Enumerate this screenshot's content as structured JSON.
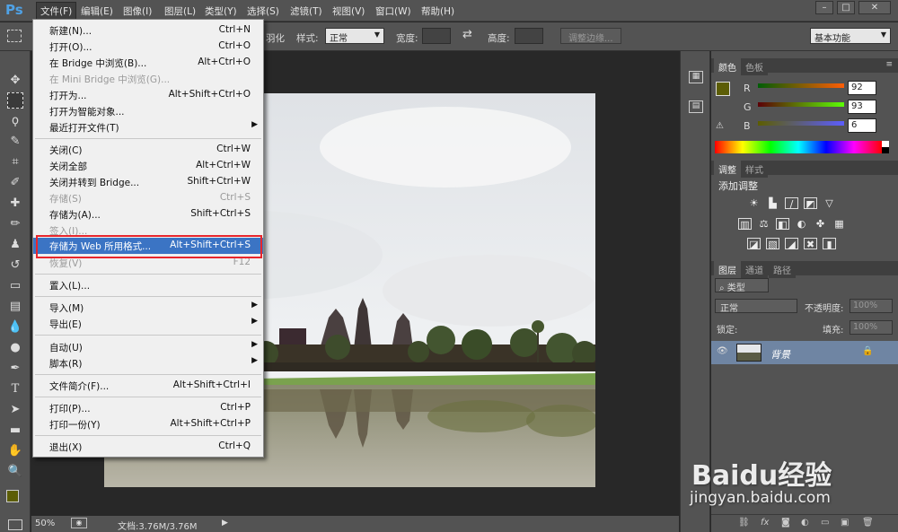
{
  "app": {
    "logo": "Ps"
  },
  "menubar": {
    "items": [
      "文件(F)",
      "编辑(E)",
      "图像(I)",
      "图层(L)",
      "类型(Y)",
      "选择(S)",
      "滤镜(T)",
      "视图(V)",
      "窗口(W)",
      "帮助(H)"
    ],
    "window_buttons": [
      "–",
      "□",
      "✕"
    ]
  },
  "options": {
    "feather_tail": "羽化",
    "style_label": "样式:",
    "style_value": "正常",
    "width_label": "宽度:",
    "height_label": "高度:",
    "refine_button": "调整边缘...",
    "workspace": "基本功能"
  },
  "file_menu": {
    "new": {
      "label": "新建(N)...",
      "shortcut": "Ctrl+N"
    },
    "open": {
      "label": "打开(O)...",
      "shortcut": "Ctrl+O"
    },
    "browse_bridge": {
      "label": "在 Bridge 中浏览(B)...",
      "shortcut": "Alt+Ctrl+O"
    },
    "browse_mini": {
      "label": "在 Mini Bridge 中浏览(G)...",
      "shortcut": ""
    },
    "open_as": {
      "label": "打开为...",
      "shortcut": "Alt+Shift+Ctrl+O"
    },
    "open_smart": {
      "label": "打开为智能对象...",
      "shortcut": ""
    },
    "recent": {
      "label": "最近打开文件(T)",
      "shortcut": ""
    },
    "close": {
      "label": "关闭(C)",
      "shortcut": "Ctrl+W"
    },
    "close_all": {
      "label": "关闭全部",
      "shortcut": "Alt+Ctrl+W"
    },
    "close_bridge": {
      "label": "关闭并转到 Bridge...",
      "shortcut": "Shift+Ctrl+W"
    },
    "save": {
      "label": "存储(S)",
      "shortcut": "Ctrl+S"
    },
    "save_as": {
      "label": "存储为(A)...",
      "shortcut": "Shift+Ctrl+S"
    },
    "checkin": {
      "label": "签入(I)...",
      "shortcut": ""
    },
    "save_web": {
      "label": "存储为 Web 所用格式...",
      "shortcut": "Alt+Shift+Ctrl+S"
    },
    "revert": {
      "label": "恢复(V)",
      "shortcut": "F12"
    },
    "place": {
      "label": "置入(L)...",
      "shortcut": ""
    },
    "import": {
      "label": "导入(M)",
      "shortcut": ""
    },
    "export": {
      "label": "导出(E)",
      "shortcut": ""
    },
    "automate": {
      "label": "自动(U)",
      "shortcut": ""
    },
    "scripts": {
      "label": "脚本(R)",
      "shortcut": ""
    },
    "file_info": {
      "label": "文件简介(F)...",
      "shortcut": "Alt+Shift+Ctrl+I"
    },
    "print": {
      "label": "打印(P)...",
      "shortcut": "Ctrl+P"
    },
    "print_one": {
      "label": "打印一份(Y)",
      "shortcut": "Alt+Shift+Ctrl+P"
    },
    "exit": {
      "label": "退出(X)",
      "shortcut": "Ctrl+Q"
    }
  },
  "status": {
    "zoom": "50%",
    "doc": "文档:3.76M/3.76M"
  },
  "color_panel": {
    "tab_color": "颜色",
    "tab_swatches": "色板",
    "r_label": "R",
    "g_label": "G",
    "b_label": "B",
    "r": "92",
    "g": "93",
    "b": "6",
    "foreground": "#5c5d06"
  },
  "adjust_panel": {
    "tab_adjust": "调整",
    "tab_styles": "样式",
    "title": "添加调整"
  },
  "layers_panel": {
    "tab_layers": "图层",
    "tab_channels": "通道",
    "tab_paths": "路径",
    "kind": "类型",
    "blend": "正常",
    "opacity_label": "不透明度:",
    "opacity": "100%",
    "lock_label": "锁定:",
    "fill_label": "填充:",
    "fill": "100%",
    "layer_name": "背景"
  },
  "watermark": {
    "brand": "Baidu经验",
    "url": "jingyan.baidu.com"
  }
}
